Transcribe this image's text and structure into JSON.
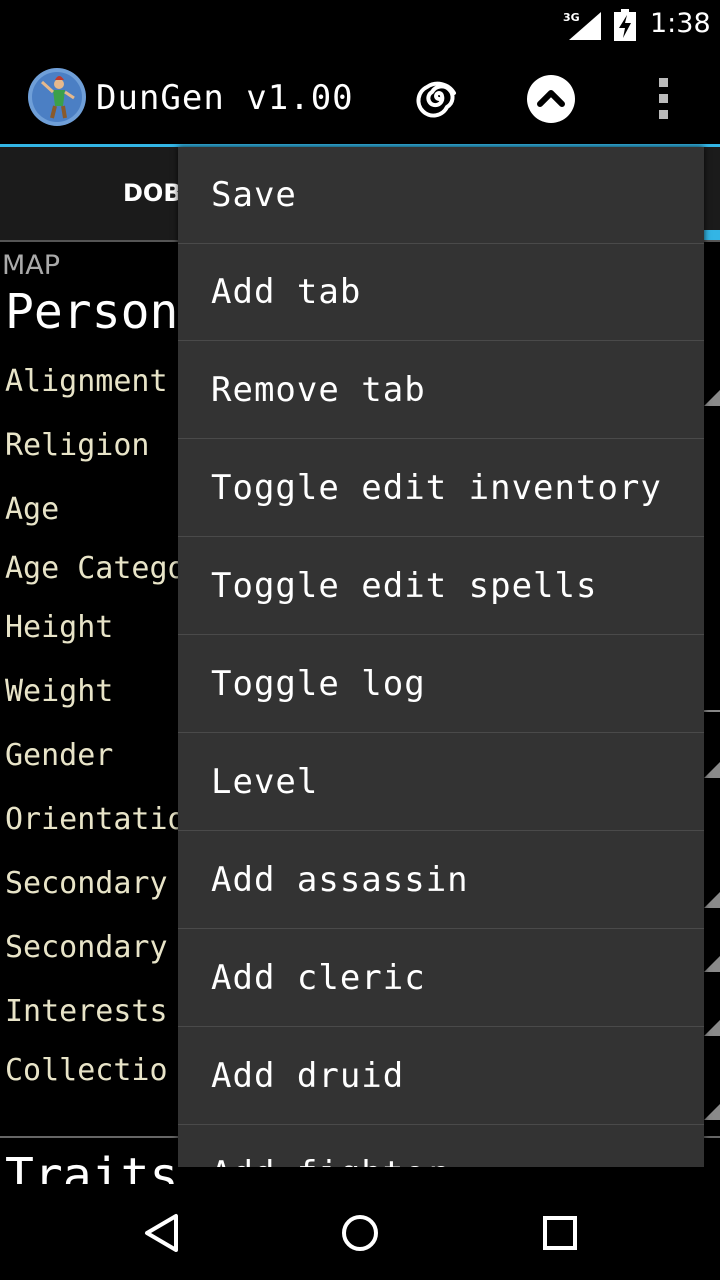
{
  "status_bar": {
    "network": "3G",
    "time": "1:38",
    "icons": [
      "signal-icon",
      "battery-charging-icon"
    ]
  },
  "action_bar": {
    "title": "DunGen v1.00",
    "icons": [
      "app-logo-icon",
      "spiral-icon",
      "chevron-up-icon",
      "overflow-menu-icon"
    ],
    "accent_color": "#33b5e5"
  },
  "tabs": {
    "active_label": "DOBA"
  },
  "content": {
    "map_label": "MAP",
    "section_title": "Person",
    "rows": [
      "Alignment",
      "Religion",
      "Age",
      "Age Catego",
      "Height",
      "Weight",
      "Gender",
      "Orientatio",
      "Secondary",
      "Secondary",
      "Interests",
      "Collectio"
    ],
    "section_title_2": "Traits"
  },
  "menu": {
    "items": [
      "Save",
      "Add tab",
      "Remove tab",
      "Toggle edit inventory",
      "Toggle edit spells",
      "Toggle log",
      "Level",
      "Add assassin",
      "Add cleric",
      "Add druid",
      "Add fighter"
    ]
  },
  "nav_bar": {
    "icons": [
      "back-icon",
      "home-icon",
      "recents-icon"
    ]
  }
}
